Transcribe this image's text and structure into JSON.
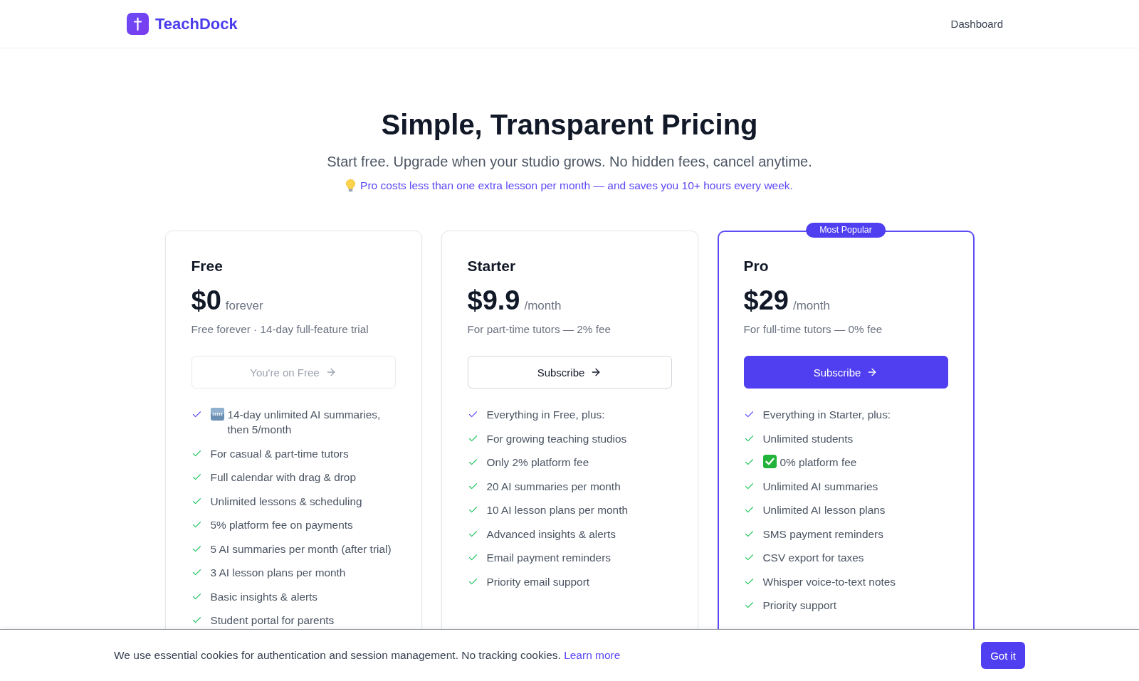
{
  "header": {
    "brand": "TeachDock",
    "nav_link": "Dashboard"
  },
  "hero": {
    "title": "Simple, Transparent Pricing",
    "subtitle": "Start free. Upgrade when your studio grows. No hidden fees, cancel anytime.",
    "tip": "Pro costs less than one extra lesson per month — and saves you 10+ hours every week."
  },
  "plans": [
    {
      "name": "Free",
      "price": "$0",
      "period": "forever",
      "description": "Free forever · 14-day full-feature trial",
      "featured": false,
      "button": {
        "label": "You're on Free",
        "kind": "outline",
        "disabled": true
      },
      "features": [
        {
          "text": "14-day unlimited AI summaries, then 5/month",
          "kind": "trial"
        },
        {
          "text": "For casual & part-time tutors",
          "kind": "feature"
        },
        {
          "text": "Full calendar with drag & drop",
          "kind": "feature"
        },
        {
          "text": "Unlimited lessons & scheduling",
          "kind": "feature"
        },
        {
          "text": "5% platform fee on payments",
          "kind": "feature"
        },
        {
          "text": "5 AI summaries per month (after trial)",
          "kind": "feature"
        },
        {
          "text": "3 AI lesson plans per month",
          "kind": "feature"
        },
        {
          "text": "Basic insights & alerts",
          "kind": "feature"
        },
        {
          "text": "Student portal for parents",
          "kind": "feature"
        }
      ]
    },
    {
      "name": "Starter",
      "price": "$9.9",
      "period": "/month",
      "description": "For part-time tutors — 2% fee",
      "featured": false,
      "button": {
        "label": "Subscribe",
        "kind": "outline",
        "disabled": false
      },
      "features": [
        {
          "text": "Everything in Free, plus:",
          "kind": "intro"
        },
        {
          "text": "For growing teaching studios",
          "kind": "feature"
        },
        {
          "text": "Only 2% platform fee",
          "kind": "feature"
        },
        {
          "text": "20 AI summaries per month",
          "kind": "feature"
        },
        {
          "text": "10 AI lesson plans per month",
          "kind": "feature"
        },
        {
          "text": "Advanced insights & alerts",
          "kind": "feature"
        },
        {
          "text": "Email payment reminders",
          "kind": "feature"
        },
        {
          "text": "Priority email support",
          "kind": "feature"
        }
      ]
    },
    {
      "name": "Pro",
      "price": "$29",
      "period": "/month",
      "description": "For full-time tutors — 0% fee",
      "featured": true,
      "badge": "Most Popular",
      "button": {
        "label": "Subscribe",
        "kind": "primary",
        "disabled": false
      },
      "features": [
        {
          "text": "Everything in Starter, plus:",
          "kind": "intro"
        },
        {
          "text": "Unlimited students",
          "kind": "feature"
        },
        {
          "text": "0% platform fee",
          "kind": "perk"
        },
        {
          "text": "Unlimited AI summaries",
          "kind": "feature"
        },
        {
          "text": "Unlimited AI lesson plans",
          "kind": "feature"
        },
        {
          "text": "SMS payment reminders",
          "kind": "feature"
        },
        {
          "text": "CSV export for taxes",
          "kind": "feature"
        },
        {
          "text": "Whisper voice-to-text notes",
          "kind": "feature"
        },
        {
          "text": "Priority support",
          "kind": "feature"
        }
      ]
    }
  ],
  "cookie_banner": {
    "text": "We use essential cookies for authentication and session management. No tracking cookies.",
    "link": "Learn more",
    "button": "Got it"
  }
}
